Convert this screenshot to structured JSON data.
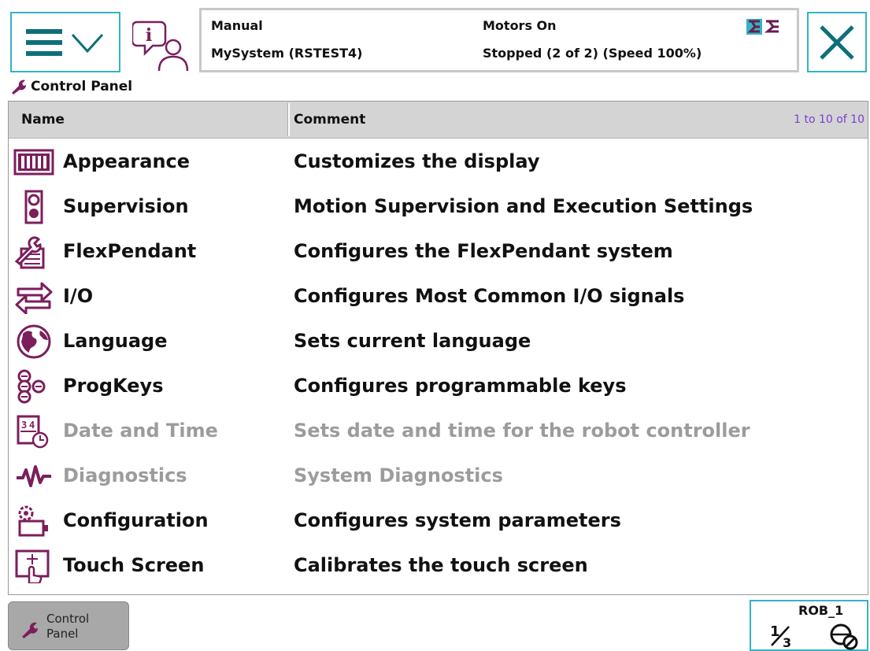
{
  "status": {
    "mode": "Manual",
    "system": "MySystem (RSTEST4)",
    "motors": "Motors On",
    "state": "Stopped (2 of 2) (Speed 100%)"
  },
  "breadcrumb": "Control Panel",
  "table": {
    "col_name": "Name",
    "col_comment": "Comment",
    "count": "1 to 10 of 10",
    "rows": [
      {
        "name": "Appearance",
        "comment": "Customizes the display",
        "icon": "appearance-icon",
        "enabled": true
      },
      {
        "name": "Supervision",
        "comment": "Motion Supervision and Execution Settings",
        "icon": "supervision-icon",
        "enabled": true
      },
      {
        "name": "FlexPendant",
        "comment": "Configures the FlexPendant system",
        "icon": "flexpendant-icon",
        "enabled": true
      },
      {
        "name": "I/O",
        "comment": "Configures Most Common I/O signals",
        "icon": "io-icon",
        "enabled": true
      },
      {
        "name": "Language",
        "comment": "Sets current language",
        "icon": "language-icon",
        "enabled": true
      },
      {
        "name": "ProgKeys",
        "comment": "Configures programmable keys",
        "icon": "progkeys-icon",
        "enabled": true
      },
      {
        "name": "Date and Time",
        "comment": "Sets date and time for the robot controller",
        "icon": "date-time-icon",
        "enabled": false
      },
      {
        "name": "Diagnostics",
        "comment": "System Diagnostics",
        "icon": "diagnostics-icon",
        "enabled": false
      },
      {
        "name": "Configuration",
        "comment": "Configures system parameters",
        "icon": "configuration-icon",
        "enabled": true
      },
      {
        "name": "Touch Screen",
        "comment": "Calibrates the touch screen",
        "icon": "touch-screen-icon",
        "enabled": true
      }
    ]
  },
  "taskbar": {
    "label_line1": "Control",
    "label_line2": "Panel"
  },
  "quickset": {
    "robot": "ROB_1"
  },
  "colors": {
    "accent": "#34b3c4",
    "icon": "#7b1e5c",
    "disabled_text": "#9c9c9c",
    "count_text": "#7a3fd0"
  }
}
